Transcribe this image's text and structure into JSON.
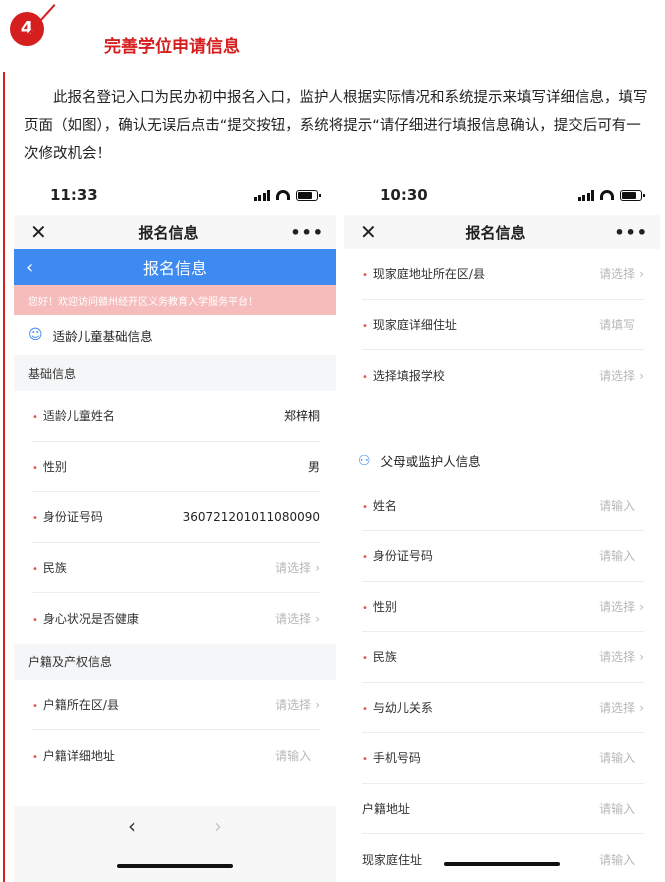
{
  "section": {
    "number": "4",
    "title": "完善学位申请信息"
  },
  "intro": "此报名登记入口为民办初中报名入口，监护人根据实际情况和系统提示来填写详细信息，填写页面（如图），确认无误后点击“提交按钮，系统将提示“请仔细进行填报信息确认，提交后可有一次修改机会！",
  "left_phone": {
    "time": "11:33",
    "nav_title": "报名信息",
    "blue_title": "报名信息",
    "notice": "您好！欢迎访问赣州经开区义务教育入学服务平台！",
    "section_title": "适龄儿童基础信息",
    "group1": "基础信息",
    "rows1": [
      {
        "label": "适龄儿童姓名",
        "value": "郑梓桐"
      },
      {
        "label": "性别",
        "value": "男"
      },
      {
        "label": "身份证号码",
        "value": "360721201011080090"
      },
      {
        "label": "民族",
        "value": "请选择"
      },
      {
        "label": "身心状况是否健康",
        "value": "请选择"
      }
    ],
    "group2": "户籍及产权信息",
    "rows2": [
      {
        "label": "户籍所在区/县",
        "value": "请选择"
      },
      {
        "label": "户籍详细地址",
        "value": "请输入"
      }
    ]
  },
  "right_phone": {
    "time": "10:30",
    "nav_title": "报名信息",
    "rows1": [
      {
        "label": "现家庭地址所在区/县",
        "value": "请选择"
      },
      {
        "label": "现家庭详细住址",
        "value": "请填写"
      },
      {
        "label": "选择填报学校",
        "value": "请选择"
      }
    ],
    "section_title": "父母或监护人信息",
    "rows2": [
      {
        "label": "姓名",
        "value": "请输入"
      },
      {
        "label": "身份证号码",
        "value": "请输入"
      },
      {
        "label": "性别",
        "value": "请选择"
      },
      {
        "label": "民族",
        "value": "请选择"
      },
      {
        "label": "与幼儿关系",
        "value": "请选择"
      },
      {
        "label": "手机号码",
        "value": "请输入"
      },
      {
        "label": "户籍地址",
        "value": "请输入"
      },
      {
        "label": "现家庭住址",
        "value": "请输入"
      }
    ]
  },
  "colors": {
    "accent_red": "#d51f1f",
    "blue_bar": "#3d8bf0",
    "notice_pink": "#f6bcbc"
  },
  "icons": {
    "close": "close-icon",
    "more": "more-dots-icon",
    "back": "back-chevron-icon",
    "child": "child-face-icon",
    "people": "people-icon"
  }
}
